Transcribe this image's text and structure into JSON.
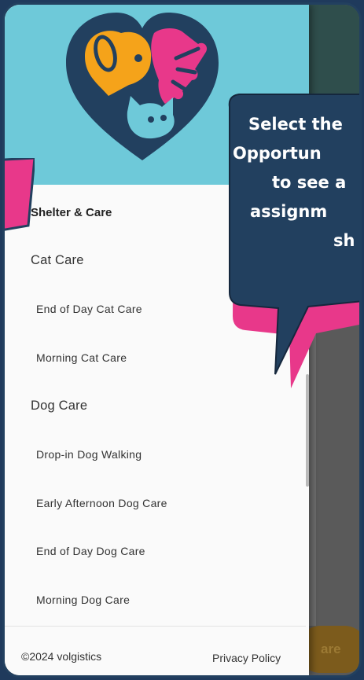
{
  "drawer": {
    "section_title": "Shelter & Care",
    "groups": [
      {
        "title": "Cat Care",
        "items": [
          "End of Day Cat Care",
          "Morning Cat Care"
        ]
      },
      {
        "title": "Dog Care",
        "items": [
          "Drop-in Dog Walking",
          "Early Afternoon Dog Care",
          "End of Day Dog Care",
          "Morning Dog Care"
        ]
      }
    ],
    "footer": {
      "copyright": "©2024 volgistics",
      "privacy_link": "Privacy Policy"
    }
  },
  "background": {
    "share_button": "are"
  },
  "callout": {
    "lines": [
      "Select the",
      "Opportun",
      "to see a",
      "assignm",
      "sh"
    ]
  },
  "colors": {
    "header_teal": "#6ec9d9",
    "accent_pink": "#e8388a",
    "callout_navy": "#22405f",
    "logo_orange": "#f5a31a"
  }
}
